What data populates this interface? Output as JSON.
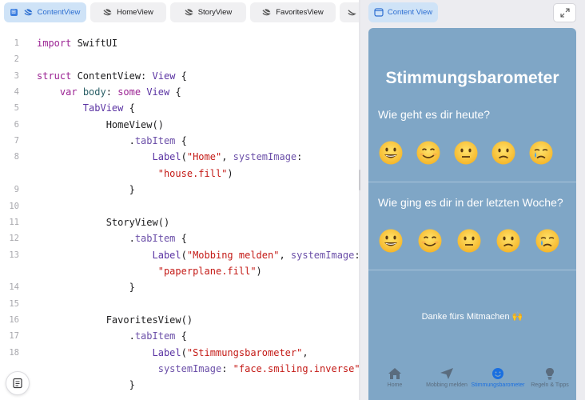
{
  "editor": {
    "tabs": [
      {
        "label": "ContentView",
        "active": true,
        "icon": "swift-icon"
      },
      {
        "label": "HomeView",
        "active": false,
        "icon": "swift-icon"
      },
      {
        "label": "StoryView",
        "active": false,
        "icon": "swift-icon"
      },
      {
        "label": "FavoritesView",
        "active": false,
        "icon": "swift-icon"
      }
    ],
    "lines": [
      {
        "n": "1",
        "tokens": [
          [
            "kw",
            "import"
          ],
          [
            "p",
            " SwiftUI"
          ]
        ]
      },
      {
        "n": "2",
        "tokens": []
      },
      {
        "n": "3",
        "tokens": [
          [
            "kw",
            "struct"
          ],
          [
            "p",
            " ContentView: "
          ],
          [
            "ty",
            "View"
          ],
          [
            "p",
            " {"
          ]
        ]
      },
      {
        "n": "4",
        "tokens": [
          [
            "p",
            "    "
          ],
          [
            "kw",
            "var"
          ],
          [
            "p",
            " "
          ],
          [
            "fn",
            "body"
          ],
          [
            "p",
            ": "
          ],
          [
            "kw",
            "some"
          ],
          [
            "p",
            " "
          ],
          [
            "ty",
            "View"
          ],
          [
            "p",
            " {"
          ]
        ]
      },
      {
        "n": "5",
        "tokens": [
          [
            "p",
            "        "
          ],
          [
            "ty",
            "TabView"
          ],
          [
            "p",
            " {"
          ]
        ]
      },
      {
        "n": "6",
        "tokens": [
          [
            "p",
            "            HomeView()"
          ]
        ]
      },
      {
        "n": "7",
        "tokens": [
          [
            "p",
            "                ."
          ],
          [
            "pm",
            "tabItem"
          ],
          [
            "p",
            " {"
          ]
        ]
      },
      {
        "n": "8",
        "tokens": [
          [
            "p",
            "                    "
          ],
          [
            "ty",
            "Label"
          ],
          [
            "p",
            "("
          ],
          [
            "st",
            "\"Home\""
          ],
          [
            "p",
            ", "
          ],
          [
            "pm",
            "systemImage"
          ],
          [
            "p",
            ":"
          ]
        ]
      },
      {
        "n": "",
        "tokens": [
          [
            "p",
            "                     "
          ],
          [
            "st",
            "\"house.fill\""
          ],
          [
            "p",
            ")"
          ]
        ]
      },
      {
        "n": "9",
        "tokens": [
          [
            "p",
            "                }"
          ]
        ]
      },
      {
        "n": "10",
        "tokens": []
      },
      {
        "n": "11",
        "tokens": [
          [
            "p",
            "            StoryView()"
          ]
        ]
      },
      {
        "n": "12",
        "tokens": [
          [
            "p",
            "                ."
          ],
          [
            "pm",
            "tabItem"
          ],
          [
            "p",
            " {"
          ]
        ]
      },
      {
        "n": "13",
        "tokens": [
          [
            "p",
            "                    "
          ],
          [
            "ty",
            "Label"
          ],
          [
            "p",
            "("
          ],
          [
            "st",
            "\"Mobbing melden\""
          ],
          [
            "p",
            ", "
          ],
          [
            "pm",
            "systemImage"
          ],
          [
            "p",
            ":"
          ]
        ]
      },
      {
        "n": "",
        "tokens": [
          [
            "p",
            "                     "
          ],
          [
            "st",
            "\"paperplane.fill\""
          ],
          [
            "p",
            ")"
          ]
        ]
      },
      {
        "n": "14",
        "tokens": [
          [
            "p",
            "                }"
          ]
        ]
      },
      {
        "n": "15",
        "tokens": []
      },
      {
        "n": "16",
        "tokens": [
          [
            "p",
            "            FavoritesView()"
          ]
        ]
      },
      {
        "n": "17",
        "tokens": [
          [
            "p",
            "                ."
          ],
          [
            "pm",
            "tabItem"
          ],
          [
            "p",
            " {"
          ]
        ]
      },
      {
        "n": "18",
        "tokens": [
          [
            "p",
            "                    "
          ],
          [
            "ty",
            "Label"
          ],
          [
            "p",
            "("
          ],
          [
            "st",
            "\"Stimmungsbarometer\""
          ],
          [
            "p",
            ","
          ]
        ]
      },
      {
        "n": "",
        "tokens": [
          [
            "p",
            "                     "
          ],
          [
            "pm",
            "systemImage"
          ],
          [
            "p",
            ": "
          ],
          [
            "st",
            "\"face.smiling.inverse\""
          ],
          [
            "p",
            ")"
          ]
        ]
      },
      {
        "n": "",
        "tokens": [
          [
            "p",
            "                }"
          ]
        ]
      }
    ],
    "doc_button_icon": "document-icon"
  },
  "preview": {
    "tab_label": "Content View",
    "tab_icon": "window-icon",
    "expand_icon": "expand-icon",
    "app": {
      "title": "Stimmungsbarometer",
      "question_today": "Wie geht es dir heute?",
      "question_week": "Wie ging es dir in der letzten Woche?",
      "moods": [
        "grinning",
        "smiling",
        "neutral",
        "slightly-frowning",
        "crying"
      ],
      "thanks": "Danke fürs Mitmachen 🙌",
      "tabs": [
        {
          "label": "Home",
          "icon": "house-icon",
          "selected": false
        },
        {
          "label": "Mobbing melden",
          "icon": "paperplane-icon",
          "selected": false
        },
        {
          "label": "Stimmungsbarometer",
          "icon": "smiley-icon",
          "selected": true
        },
        {
          "label": "Regeln & Tipps",
          "icon": "lightbulb-icon",
          "selected": false
        }
      ]
    }
  },
  "colors": {
    "accent": "#2d6fd1",
    "preview_background": "#7fa6c6",
    "tab_selected": "#1a6fe0"
  }
}
